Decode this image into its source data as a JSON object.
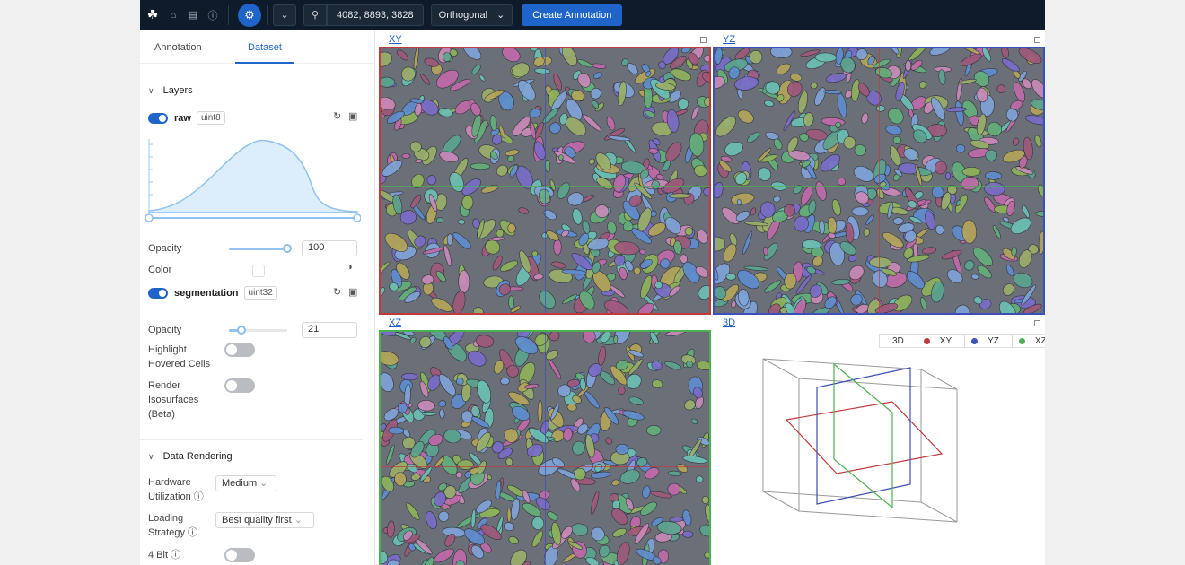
{
  "topbar": {
    "coordinates": "4082, 8893, 3828",
    "view_mode": "Orthogonal",
    "create_label": "Create Annotation"
  },
  "panel": {
    "tabs": [
      "Annotation",
      "Dataset"
    ],
    "active_tab": "Dataset",
    "layers_title": "Layers",
    "raw": {
      "name": "raw",
      "dtype": "uint8",
      "opacity": "100",
      "opacity_fraction": 1.0,
      "opacity_label": "Opacity",
      "color_label": "Color"
    },
    "segmentation": {
      "name": "segmentation",
      "dtype": "uint32",
      "opacity_label": "Opacity",
      "opacity": "21",
      "opacity_fraction": 0.21,
      "highlight_label_1": "Highlight",
      "highlight_label_2": "Hovered Cells",
      "render_label_1": "Render",
      "render_label_2": "Isosurfaces",
      "render_label_3": "(Beta)"
    },
    "data_rendering": {
      "title": "Data Rendering",
      "hw_label_1": "Hardware",
      "hw_label_2": "Utilization",
      "hw_value": "Medium",
      "loading_label_1": "Loading",
      "loading_label_2": "Strategy",
      "loading_value": "Best quality first",
      "fourbit_label": "4 Bit"
    }
  },
  "viewports": {
    "xy": "XY",
    "yz": "YZ",
    "xz": "XZ",
    "td": "3D",
    "legend": [
      "3D",
      "XY",
      "YZ",
      "XZ"
    ]
  },
  "colors": {
    "accent": "#1f64c8",
    "xy": "#c0393b",
    "yz": "#3d4fb8",
    "xz": "#4caf50"
  }
}
